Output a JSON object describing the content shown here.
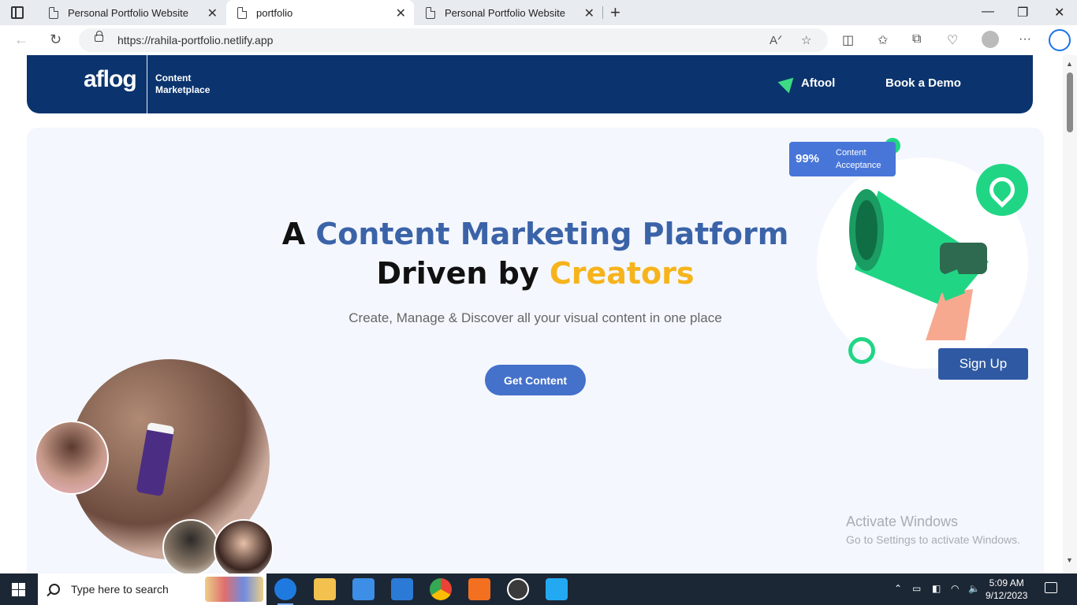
{
  "browser": {
    "tabs": [
      {
        "label": "Personal Portfolio Website",
        "active": false
      },
      {
        "label": "portfolio",
        "active": true
      },
      {
        "label": "Personal Portfolio Website",
        "active": false
      }
    ],
    "url": "https://rahila-portfolio.netlify.app"
  },
  "site": {
    "logo": "aflog",
    "logo_sub_1": "Content",
    "logo_sub_2": "Marketplace",
    "nav_aftool": "Aftool",
    "nav_demo": "Book a Demo",
    "headline_part1": "A ",
    "headline_part2": "Content Marketing Platform",
    "headline_part3": "Driven by ",
    "headline_part4": "Creators",
    "subline": "Create, Manage & Discover all your visual content in one place",
    "cta": "Get Content",
    "badge_pct": "99%",
    "badge_label_1": "Content",
    "badge_label_2": "Acceptance",
    "signup": "Sign Up",
    "colors": {
      "navy": "#0b346e",
      "blue": "#3b63a8",
      "gold": "#f6b31b",
      "green": "#20d685",
      "cta": "#4471c9"
    }
  },
  "watermark": {
    "line1": "Activate Windows",
    "line2": "Go to Settings to activate Windows."
  },
  "taskbar": {
    "search_placeholder": "Type here to search",
    "time": "5:09 AM",
    "date": "9/12/2023"
  }
}
